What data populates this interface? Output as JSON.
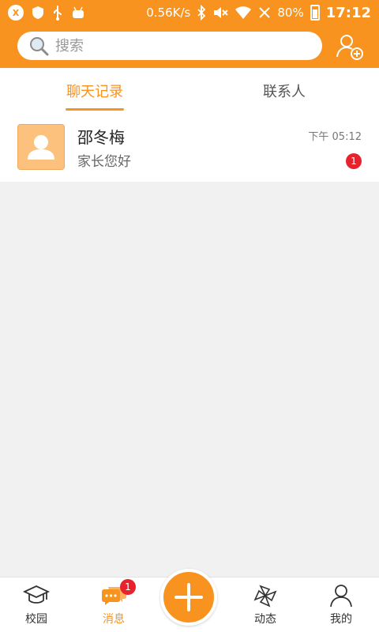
{
  "status_bar": {
    "app_badge": "X",
    "speed": "0.56K/s",
    "battery": "80%",
    "time": "17:12"
  },
  "search": {
    "placeholder": "搜索"
  },
  "tabs": [
    {
      "label": "聊天记录",
      "active": true
    },
    {
      "label": "联系人",
      "active": false
    }
  ],
  "chats": [
    {
      "name": "邵冬梅",
      "preview": "家长您好",
      "time": "下午 05:12",
      "unread": "1"
    }
  ],
  "bottom_nav": {
    "items": [
      {
        "label": "校园",
        "active": false
      },
      {
        "label": "消息",
        "active": true,
        "badge": "1"
      },
      {
        "label": "动态",
        "active": false
      },
      {
        "label": "我的",
        "active": false
      }
    ]
  },
  "colors": {
    "brand": "#f7931e",
    "badge": "#e8222c",
    "avatar": "#fcc17c"
  }
}
